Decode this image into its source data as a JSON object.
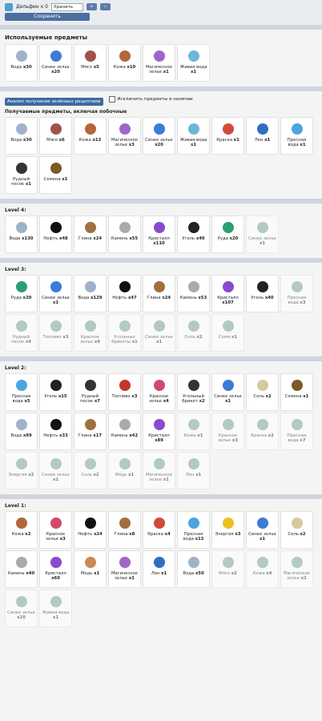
{
  "top": {
    "item": "Дельфин x 0",
    "select": "Хранить",
    "save": "Сохранить"
  },
  "used": {
    "title": "Используемые предметы",
    "items": [
      {
        "n": "Вода",
        "q": "x30",
        "c": "#9fb3c8"
      },
      {
        "n": "Синее зелье",
        "q": "x20",
        "c": "#3c7bd6"
      },
      {
        "n": "Мясо",
        "q": "x5",
        "c": "#a0524b"
      },
      {
        "n": "Кожа",
        "q": "x10",
        "c": "#b3673a"
      },
      {
        "n": "Магическое зелье",
        "q": "x1",
        "c": "#9e66c8"
      },
      {
        "n": "Живая вода",
        "q": "x1",
        "c": "#6cb7d8"
      }
    ]
  },
  "analysis": {
    "button": "Анализ получения зелёнаых рецептами",
    "check": "Исключить предметы в наличии"
  },
  "received": {
    "title": "Получаемые предметы, включая побочные",
    "items": [
      {
        "n": "Вода",
        "q": "x30",
        "c": "#9fb3c8"
      },
      {
        "n": "Мясо",
        "q": "x6",
        "c": "#a0524b"
      },
      {
        "n": "Кожа",
        "q": "x13",
        "c": "#b3673a"
      },
      {
        "n": "Магическое зелье",
        "q": "x3",
        "c": "#9e66c8"
      },
      {
        "n": "Синее зелье",
        "q": "x20",
        "c": "#3c7bd6"
      },
      {
        "n": "Живая вода",
        "q": "x1",
        "c": "#6cb7d8"
      },
      {
        "n": "Краска",
        "q": "x1",
        "c": "#d24a3a"
      },
      {
        "n": "Лен",
        "q": "x1",
        "c": "#2f6fc0"
      },
      {
        "n": "Пресная вода",
        "q": "x1",
        "c": "#4da4e0"
      },
      {
        "n": "Рудный песок",
        "q": "x1",
        "c": "#333"
      },
      {
        "n": "Семена",
        "q": "x1",
        "c": "#7b5a28"
      }
    ]
  },
  "level4": {
    "title": "Level 4:",
    "items": [
      {
        "n": "Вода",
        "q": "x130",
        "c": "#9fb3c8"
      },
      {
        "n": "Нефть",
        "q": "x48",
        "c": "#111"
      },
      {
        "n": "Глина",
        "q": "x24",
        "c": "#a07040"
      },
      {
        "n": "Камень",
        "q": "x55",
        "c": "#aaa"
      },
      {
        "n": "Кристалл",
        "q": "x110",
        "c": "#8a4ad0"
      },
      {
        "n": "Уголь",
        "q": "x40",
        "c": "#222"
      },
      {
        "n": "Руда",
        "q": "x20",
        "c": "#2aa070"
      },
      {
        "n": "Синее зелье",
        "q": "x1",
        "c": "#7ea996",
        "f": true
      }
    ]
  },
  "level3": {
    "title": "Level 3:",
    "items": [
      {
        "n": "Руда",
        "q": "x20",
        "c": "#2aa070"
      },
      {
        "n": "Синее зелье",
        "q": "x1",
        "c": "#3c7bd6"
      },
      {
        "n": "Вода",
        "q": "x129",
        "c": "#9fb3c8"
      },
      {
        "n": "Нефть",
        "q": "x47",
        "c": "#111"
      },
      {
        "n": "Глина",
        "q": "x24",
        "c": "#a07040"
      },
      {
        "n": "Камень",
        "q": "x53",
        "c": "#aaa"
      },
      {
        "n": "Кристалл",
        "q": "x107",
        "c": "#8a4ad0"
      },
      {
        "n": "Уголь",
        "q": "x40",
        "c": "#222"
      },
      {
        "n": "Пресная вода",
        "q": "x3",
        "c": "#7ea996",
        "f": true
      },
      {
        "n": "Рудный песок",
        "q": "x4",
        "c": "#7ea996",
        "f": true
      },
      {
        "n": "Топливо",
        "q": "x3",
        "c": "#7ea996",
        "f": true
      },
      {
        "n": "Красное зелье",
        "q": "x4",
        "c": "#7ea996",
        "f": true
      },
      {
        "n": "Угольные брикеты",
        "q": "x1",
        "c": "#7ea996",
        "f": true
      },
      {
        "n": "Синее зелье",
        "q": "x1",
        "c": "#7ea996",
        "f": true
      },
      {
        "n": "Соль",
        "q": "x2",
        "c": "#7ea996",
        "f": true
      },
      {
        "n": "Семя",
        "q": "x1",
        "c": "#7ea996",
        "f": true
      }
    ]
  },
  "level2": {
    "title": "Level 2:",
    "items": [
      {
        "n": "Пресная вода",
        "q": "x5",
        "c": "#4da4e0"
      },
      {
        "n": "Уголь",
        "q": "x15",
        "c": "#222"
      },
      {
        "n": "Рудный песок",
        "q": "x7",
        "c": "#333"
      },
      {
        "n": "Топливо",
        "q": "x3",
        "c": "#c0392b"
      },
      {
        "n": "Красное зелье",
        "q": "x4",
        "c": "#d24a6a"
      },
      {
        "n": "Угольный брикет",
        "q": "x2",
        "c": "#333"
      },
      {
        "n": "Синее зелье",
        "q": "x1",
        "c": "#3c7bd6"
      },
      {
        "n": "Соль",
        "q": "x2",
        "c": "#d8c8a0"
      },
      {
        "n": "Семена",
        "q": "x1",
        "c": "#7b5a28"
      },
      {
        "n": "Вода",
        "q": "x99",
        "c": "#9fb3c8"
      },
      {
        "n": "Нефть",
        "q": "x33",
        "c": "#111"
      },
      {
        "n": "Глина",
        "q": "x17",
        "c": "#a07040"
      },
      {
        "n": "Камень",
        "q": "x42",
        "c": "#aaa"
      },
      {
        "n": "Кристалл",
        "q": "x89",
        "c": "#8a4ad0"
      },
      {
        "n": "Кожа",
        "q": "x1",
        "c": "#7ea996",
        "f": true
      },
      {
        "n": "Красное зелье",
        "q": "x3",
        "c": "#7ea996",
        "f": true
      },
      {
        "n": "Краска",
        "q": "x2",
        "c": "#7ea996",
        "f": true
      },
      {
        "n": "Пресная вода",
        "q": "x7",
        "c": "#7ea996",
        "f": true
      },
      {
        "n": "Энергия",
        "q": "x2",
        "c": "#7ea996",
        "f": true
      },
      {
        "n": "Синее зелье",
        "q": "x1",
        "c": "#7ea996",
        "f": true
      },
      {
        "n": "Соль",
        "q": "x2",
        "c": "#7ea996",
        "f": true
      },
      {
        "n": "Медь",
        "q": "x1",
        "c": "#7ea996",
        "f": true
      },
      {
        "n": "Магическое зелье",
        "q": "x1",
        "c": "#7ea996",
        "f": true
      },
      {
        "n": "Лен",
        "q": "x1",
        "c": "#7ea996",
        "f": true
      }
    ]
  },
  "level1": {
    "title": "Level 1:",
    "items": [
      {
        "n": "Кожа",
        "q": "x2",
        "c": "#b3673a"
      },
      {
        "n": "Красное зелье",
        "q": "x3",
        "c": "#d24a6a"
      },
      {
        "n": "Нефть",
        "q": "x24",
        "c": "#111"
      },
      {
        "n": "Глина",
        "q": "x8",
        "c": "#a07040"
      },
      {
        "n": "Краска",
        "q": "x4",
        "c": "#d24a3a"
      },
      {
        "n": "Пресная вода",
        "q": "x13",
        "c": "#4da4e0"
      },
      {
        "n": "Энергия",
        "q": "x3",
        "c": "#f0c020"
      },
      {
        "n": "Синее зелье",
        "q": "x1",
        "c": "#3c7bd6"
      },
      {
        "n": "Соль",
        "q": "x2",
        "c": "#d8c8a0"
      },
      {
        "n": "Камень",
        "q": "x40",
        "c": "#aaa"
      },
      {
        "n": "Кристалл",
        "q": "x60",
        "c": "#8a4ad0"
      },
      {
        "n": "Медь",
        "q": "x1",
        "c": "#c98a5a"
      },
      {
        "n": "Магическое зелье",
        "q": "x1",
        "c": "#9e66c8"
      },
      {
        "n": "Лен",
        "q": "x1",
        "c": "#2f6fc0"
      },
      {
        "n": "Вода",
        "q": "x50",
        "c": "#9fb3c8"
      },
      {
        "n": "Мясо",
        "q": "x2",
        "c": "#7ea996",
        "f": true
      },
      {
        "n": "Кожа",
        "q": "x4",
        "c": "#7ea996",
        "f": true
      },
      {
        "n": "Магическое зелье",
        "q": "x1",
        "c": "#7ea996",
        "f": true
      },
      {
        "n": "Синее зелье",
        "q": "x20",
        "c": "#7ea996",
        "f": true
      },
      {
        "n": "Живая вода",
        "q": "x1",
        "c": "#7ea996",
        "f": true
      }
    ]
  }
}
